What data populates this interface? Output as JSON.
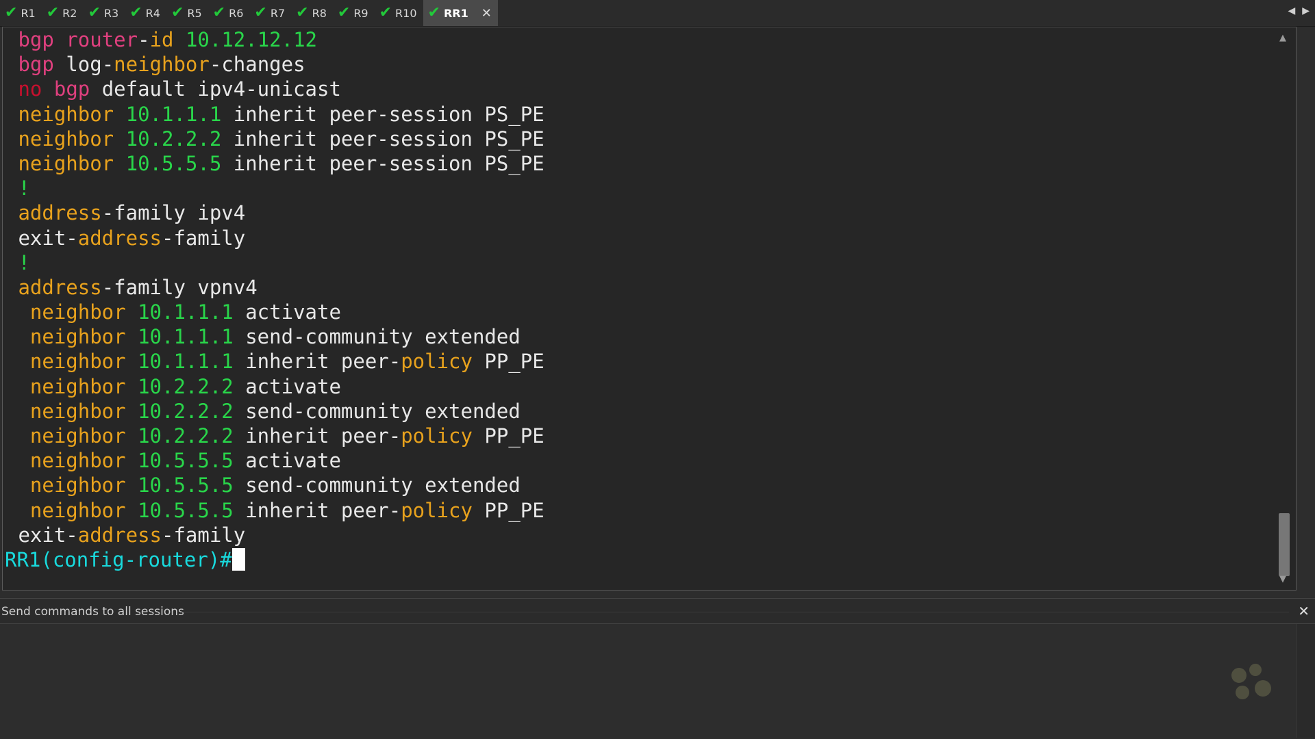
{
  "tabs": [
    {
      "label": "R1",
      "status": "connected"
    },
    {
      "label": "R2",
      "status": "connected"
    },
    {
      "label": "R3",
      "status": "connected"
    },
    {
      "label": "R4",
      "status": "connected"
    },
    {
      "label": "R5",
      "status": "connected"
    },
    {
      "label": "R6",
      "status": "connected"
    },
    {
      "label": "R7",
      "status": "connected"
    },
    {
      "label": "R8",
      "status": "connected"
    },
    {
      "label": "R9",
      "status": "connected"
    },
    {
      "label": "R10",
      "status": "connected"
    },
    {
      "label": "RR1",
      "status": "connected",
      "active": true
    }
  ],
  "icons": {
    "tab_status": "check-icon",
    "tab_close": "close-icon",
    "nav_left": "arrow-left-icon",
    "nav_right": "arrow-right-icon"
  },
  "colors": {
    "check": "#22c93a",
    "keyword_pink": "#e0407f",
    "keyword_orange": "#e8a21d",
    "number_green": "#29d64a",
    "negation_red": "#c8102e",
    "prompt_cyan": "#19d9dc"
  },
  "terminal": {
    "lines": [
      [
        {
          "t": " "
        },
        {
          "t": "bgp",
          "c": "pink"
        },
        {
          "t": " "
        },
        {
          "t": "router",
          "c": "pink"
        },
        {
          "t": "-"
        },
        {
          "t": "id",
          "c": "orange"
        },
        {
          "t": " "
        },
        {
          "t": "10.12.12.12",
          "c": "green"
        }
      ],
      [
        {
          "t": " "
        },
        {
          "t": "bgp",
          "c": "pink"
        },
        {
          "t": " log-"
        },
        {
          "t": "neighbor",
          "c": "orange"
        },
        {
          "t": "-changes"
        }
      ],
      [
        {
          "t": " "
        },
        {
          "t": "no",
          "c": "red"
        },
        {
          "t": " "
        },
        {
          "t": "bgp",
          "c": "pink"
        },
        {
          "t": " default ipv4-unicast"
        }
      ],
      [
        {
          "t": " "
        },
        {
          "t": "neighbor",
          "c": "orange"
        },
        {
          "t": " "
        },
        {
          "t": "10.1.1.1",
          "c": "green"
        },
        {
          "t": " inherit peer-session PS_PE"
        }
      ],
      [
        {
          "t": " "
        },
        {
          "t": "neighbor",
          "c": "orange"
        },
        {
          "t": " "
        },
        {
          "t": "10.2.2.2",
          "c": "green"
        },
        {
          "t": " inherit peer-session PS_PE"
        }
      ],
      [
        {
          "t": " "
        },
        {
          "t": "neighbor",
          "c": "orange"
        },
        {
          "t": " "
        },
        {
          "t": "10.5.5.5",
          "c": "green"
        },
        {
          "t": " inherit peer-session PS_PE"
        }
      ],
      [
        {
          "t": " "
        },
        {
          "t": "!",
          "c": "green"
        }
      ],
      [
        {
          "t": " "
        },
        {
          "t": "address",
          "c": "orange"
        },
        {
          "t": "-family ipv4"
        }
      ],
      [
        {
          "t": " exit-"
        },
        {
          "t": "address",
          "c": "orange"
        },
        {
          "t": "-family"
        }
      ],
      [
        {
          "t": " "
        },
        {
          "t": "!",
          "c": "green"
        }
      ],
      [
        {
          "t": " "
        },
        {
          "t": "address",
          "c": "orange"
        },
        {
          "t": "-family vpnv4"
        }
      ],
      [
        {
          "t": "  "
        },
        {
          "t": "neighbor",
          "c": "orange"
        },
        {
          "t": " "
        },
        {
          "t": "10.1.1.1",
          "c": "green"
        },
        {
          "t": " activate"
        }
      ],
      [
        {
          "t": "  "
        },
        {
          "t": "neighbor",
          "c": "orange"
        },
        {
          "t": " "
        },
        {
          "t": "10.1.1.1",
          "c": "green"
        },
        {
          "t": " send-community extended"
        }
      ],
      [
        {
          "t": "  "
        },
        {
          "t": "neighbor",
          "c": "orange"
        },
        {
          "t": " "
        },
        {
          "t": "10.1.1.1",
          "c": "green"
        },
        {
          "t": " inherit peer-"
        },
        {
          "t": "policy",
          "c": "orange"
        },
        {
          "t": " PP_PE"
        }
      ],
      [
        {
          "t": "  "
        },
        {
          "t": "neighbor",
          "c": "orange"
        },
        {
          "t": " "
        },
        {
          "t": "10.2.2.2",
          "c": "green"
        },
        {
          "t": " activate"
        }
      ],
      [
        {
          "t": "  "
        },
        {
          "t": "neighbor",
          "c": "orange"
        },
        {
          "t": " "
        },
        {
          "t": "10.2.2.2",
          "c": "green"
        },
        {
          "t": " send-community extended"
        }
      ],
      [
        {
          "t": "  "
        },
        {
          "t": "neighbor",
          "c": "orange"
        },
        {
          "t": " "
        },
        {
          "t": "10.2.2.2",
          "c": "green"
        },
        {
          "t": " inherit peer-"
        },
        {
          "t": "policy",
          "c": "orange"
        },
        {
          "t": " PP_PE"
        }
      ],
      [
        {
          "t": "  "
        },
        {
          "t": "neighbor",
          "c": "orange"
        },
        {
          "t": " "
        },
        {
          "t": "10.5.5.5",
          "c": "green"
        },
        {
          "t": " activate"
        }
      ],
      [
        {
          "t": "  "
        },
        {
          "t": "neighbor",
          "c": "orange"
        },
        {
          "t": " "
        },
        {
          "t": "10.5.5.5",
          "c": "green"
        },
        {
          "t": " send-community extended"
        }
      ],
      [
        {
          "t": "  "
        },
        {
          "t": "neighbor",
          "c": "orange"
        },
        {
          "t": " "
        },
        {
          "t": "10.5.5.5",
          "c": "green"
        },
        {
          "t": " inherit peer-"
        },
        {
          "t": "policy",
          "c": "orange"
        },
        {
          "t": " PP_PE"
        }
      ],
      [
        {
          "t": " exit-"
        },
        {
          "t": "address",
          "c": "orange"
        },
        {
          "t": "-family"
        }
      ]
    ],
    "prompt": "RR1(config-router)#"
  },
  "send_bar": {
    "label": "Send commands to all sessions"
  }
}
